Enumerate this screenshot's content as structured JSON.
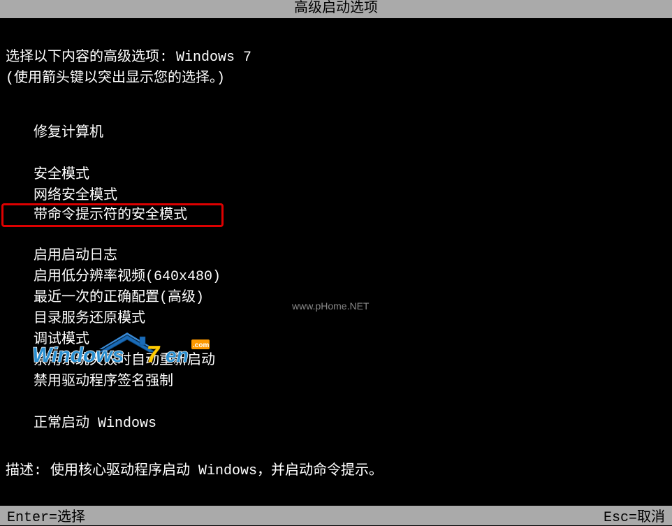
{
  "title": "高级启动选项",
  "intro_prefix": "选择以下内容的高级选项: ",
  "os_name": "Windows 7",
  "intro_hint": "(使用箭头键以突出显示您的选择。)",
  "menu": {
    "repair": "修复计算机",
    "safe_mode": "安全模式",
    "safe_mode_network": "网络安全模式",
    "safe_mode_cmd": "带命令提示符的安全模式",
    "boot_log": "启用启动日志",
    "low_res": "启用低分辨率视频(640x480)",
    "last_known": "最近一次的正确配置(高级)",
    "dsrm": "目录服务还原模式",
    "debug": "调试模式",
    "disable_auto_restart": "禁用系统失败时自动重新启动",
    "disable_driver_sig": "禁用驱动程序签名强制",
    "normal_start": "正常启动 Windows"
  },
  "description_prefix": "描述: ",
  "description_text": "使用核心驱动程序启动 Windows，并启动命令提示。",
  "footer": {
    "enter": "Enter=选择",
    "esc": "Esc=取消"
  },
  "watermark1": "www.pHome.NET",
  "logo_text_main": "Windows",
  "logo_text_num": "7",
  "logo_text_suffix": "en",
  "logo_dotcom": ".com"
}
